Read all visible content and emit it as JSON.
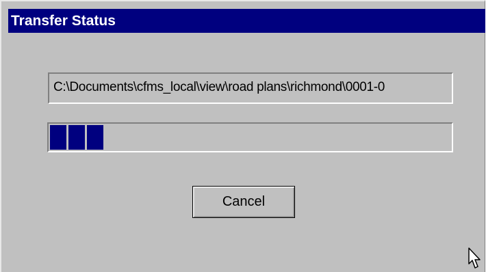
{
  "window": {
    "title": "Transfer Status"
  },
  "transfer": {
    "current_path": "C:\\Documents\\cfms_local\\view\\road plans\\richmond\\0001-0"
  },
  "progress": {
    "filled_blocks": 3,
    "approx_fraction": 0.14,
    "bar_color": "#00007f"
  },
  "buttons": {
    "cancel_label": "Cancel"
  },
  "colors": {
    "titlebar": "#00007f",
    "window_face": "#c0c0c0"
  },
  "icons": {
    "pointer": "mouse-pointer-icon"
  }
}
